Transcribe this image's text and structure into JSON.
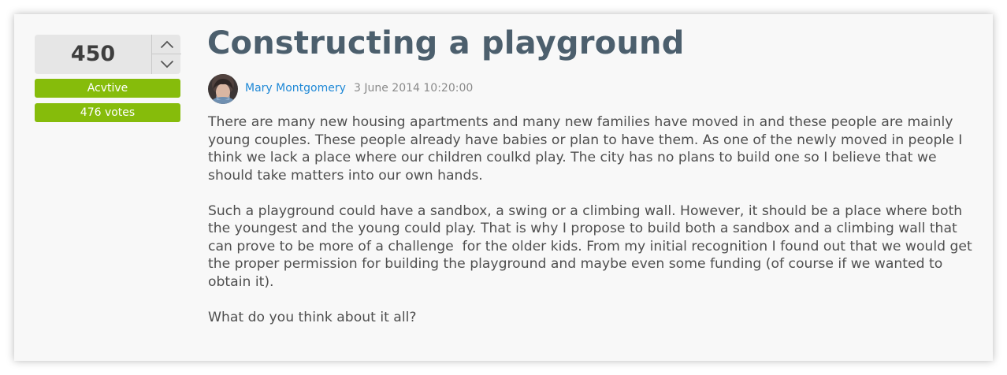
{
  "post": {
    "title": "Constructing a playground",
    "author": "Mary Montgomery",
    "date": "3 June 2014 10:20:00",
    "paragraphs": [
      "There are many new housing apartments and many new families have moved in and these people are mainly young couples. These people already have babies or plan to have them. As one of the newly moved in people I think we lack a place where our children coulkd play. The city has no plans to build one so I believe that we should take matters into our own hands.",
      "Such a playground could have a sandbox, a swing or a climbing wall. However, it should be a place where both the youngest and the young could play. That is why I propose to build both a sandbox and a climbing wall that can prove to be more of a challenge  for the older kids. From my initial recognition I found out that we would get the proper permission for building the playground and maybe even some funding (of course if we wanted to obtain it).",
      "What do you think about it all?"
    ]
  },
  "vote": {
    "score": "450",
    "status": "Acvtive",
    "votes_label": "476 votes",
    "up_icon": "chevron-up-icon",
    "down_icon": "chevron-down-icon"
  },
  "colors": {
    "badge": "#86bc0b",
    "title": "#4c5f6d",
    "author_link": "#1e88d6"
  }
}
